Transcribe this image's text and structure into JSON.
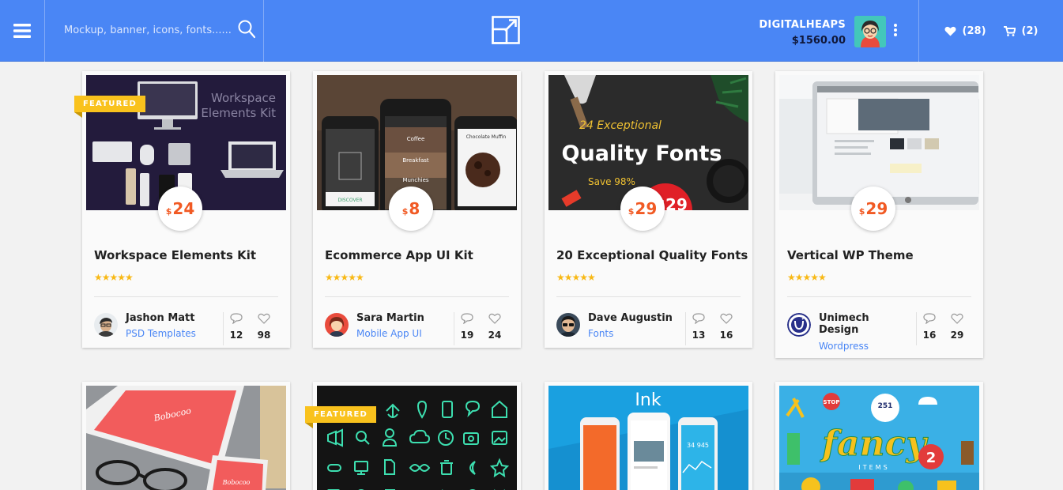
{
  "header": {
    "search_placeholder": "Mockup, banner, icons, fonts......",
    "user_name": "DIGITALHEAPS",
    "user_balance": "$1560.00",
    "wishlist_count": "(28)",
    "cart_count": "(2)"
  },
  "colors": {
    "primary": "#4a86f5",
    "price": "#f15a24",
    "featured": "#f9c21d",
    "link": "#4a86f5"
  },
  "products": [
    {
      "title": "Workspace Elements Kit",
      "featured_label": "FEATURED",
      "price_currency": "$",
      "price": "24",
      "rating": "★★★★★",
      "author": "Jashon Matt",
      "category": "PSD Templates",
      "comments": "12",
      "likes": "98",
      "thumb_text_line1": "Workspace",
      "thumb_text_line2": "Elements Kit"
    },
    {
      "title": "Ecommerce App UI Kit",
      "price_currency": "$",
      "price": "8",
      "rating": "★★★★★",
      "author": "Sara Martin",
      "category": "Mobile App UI",
      "comments": "19",
      "likes": "24",
      "thumb_text_line1": "Coffee",
      "thumb_text_line2": "Breakfast",
      "thumb_text_line3": "Munchies",
      "thumb_text_line4": "DISCOVER",
      "thumb_text_line5": "Chocolate Muffin"
    },
    {
      "title": "20 Exceptional Quality Fonts",
      "price_currency": "$",
      "price": "29",
      "rating": "★★★★★",
      "author": "Dave Augustin",
      "category": "Fonts",
      "comments": "13",
      "likes": "16",
      "thumb_text_line1": "24 Exceptional",
      "thumb_text_line2": "Quality Fonts",
      "thumb_text_line3": "Save 98%",
      "thumb_text_line4": "$29"
    },
    {
      "title": "Vertical WP Theme",
      "price_currency": "$",
      "price": "29",
      "rating": "★★★★★",
      "author": "Unimech Design",
      "category": "Wordpress",
      "comments": "16",
      "likes": "29"
    }
  ],
  "row2": [
    {
      "thumb_text_line1": "Bobocoo"
    },
    {
      "featured_label": "FEATURED"
    },
    {
      "thumb_text_line1": "Ink",
      "thumb_text_line2": "34 945"
    },
    {
      "thumb_text_line1": "fancy",
      "thumb_text_line2": "ITEMS",
      "thumb_text_line3": "251",
      "thumb_text_line4": "2",
      "thumb_text_line5": "STOP"
    }
  ]
}
